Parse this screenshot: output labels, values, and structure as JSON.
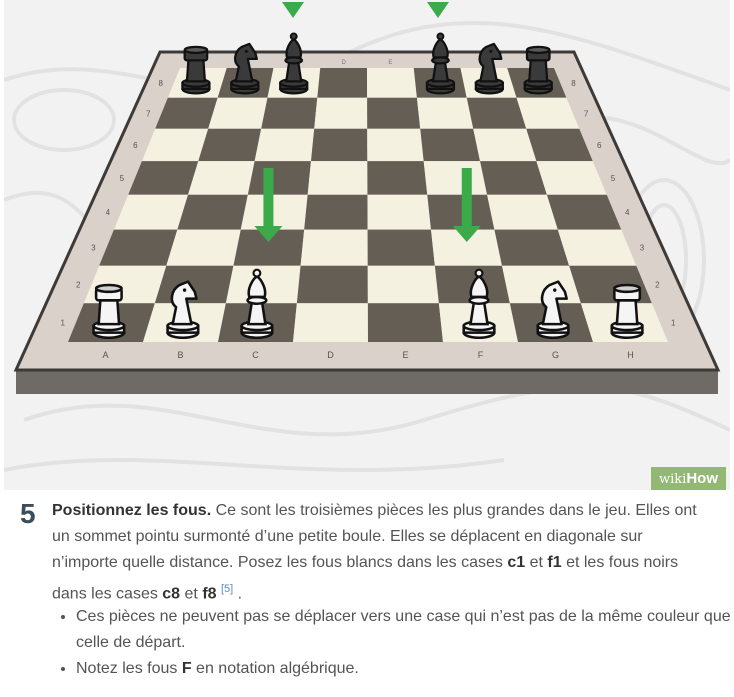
{
  "board": {
    "files": [
      "A",
      "B",
      "C",
      "D",
      "E",
      "F",
      "G",
      "H"
    ],
    "ranks": [
      "1",
      "2",
      "3",
      "4",
      "5",
      "6",
      "7",
      "8"
    ],
    "top_files": [
      "D",
      "E"
    ],
    "light_square_color": "#f4f1e1",
    "dark_square_color": "#655e55",
    "frame_color": "#d8d0c8"
  },
  "brand": {
    "wiki": "wiki",
    "how": "How",
    "color": "#93b874"
  },
  "step": {
    "number": "5",
    "title": "Positionnez les fous.",
    "text1": " Ce sont les troisièmes pièces les plus grandes dans le jeu. Elles ont un sommet pointu surmonté d’une petite boule. Elles se déplacent en diagonale sur n’importe quelle distance. Posez les fous blancs dans les cases ",
    "sq1": "c1",
    "and1": " et ",
    "sq2": "f1",
    "text2": " et les fous noirs dans les cases ",
    "sq3": "c8",
    "and2": " et ",
    "sq4": "f8",
    "ref": "[5]",
    "end": " ."
  },
  "bullets": {
    "b1": "Ces pièces ne peuvent pas se déplacer vers une case qui n’est pas de la même couleur que celle de départ.",
    "b2_pre": "Notez les fous ",
    "b2_letter": "F",
    "b2_post": " en notation algébrique."
  }
}
